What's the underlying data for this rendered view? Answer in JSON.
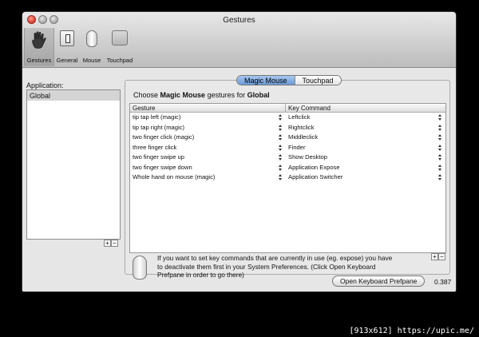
{
  "window": {
    "title": "Gestures"
  },
  "toolbar": {
    "items": [
      {
        "label": "Gestures",
        "icon": "hand-icon",
        "selected": true
      },
      {
        "label": "General",
        "icon": "general-icon",
        "selected": false
      },
      {
        "label": "Mouse",
        "icon": "mouse-icon",
        "selected": false
      },
      {
        "label": "Touchpad",
        "icon": "touchpad-icon",
        "selected": false
      }
    ]
  },
  "sidebar": {
    "label": "Application:",
    "items": [
      {
        "label": "Global",
        "selected": true
      }
    ],
    "add": "+",
    "remove": "−"
  },
  "segment": {
    "options": [
      "Magic Mouse",
      "Touchpad"
    ],
    "selected": "Magic Mouse"
  },
  "main": {
    "choose_prefix": "Choose",
    "device": "Magic Mouse",
    "choose_mid": "gestures for",
    "app": "Global",
    "columns": [
      "Gesture",
      "Key Command"
    ],
    "rows": [
      {
        "gesture": "tip tap left (magic)",
        "command": "Leftclick"
      },
      {
        "gesture": "tip tap right (magic)",
        "command": "Rightclick"
      },
      {
        "gesture": "two finger click (magic)",
        "command": "Middleclick"
      },
      {
        "gesture": "three finger click",
        "command": "Finder"
      },
      {
        "gesture": "two finger swipe up",
        "command": "Show Desktop"
      },
      {
        "gesture": "two finger swipe down",
        "command": "Application Expose"
      },
      {
        "gesture": "Whole hand on mouse (magic)",
        "command": "Application Switcher"
      }
    ],
    "add": "+",
    "remove": "−",
    "info": "If you want to set key commands that are currently in use (eg. expose) you have to deactivate them first in your System Preferences. (Click Open Keyboard Prefpane in order to go there)"
  },
  "footer": {
    "open_button": "Open Keyboard Prefpane",
    "version": "0.387"
  },
  "caption": "[913x612] https://upic.me/",
  "colors": {
    "selection_blue": "#6a9ad8",
    "close_red": "#d63a2b"
  }
}
